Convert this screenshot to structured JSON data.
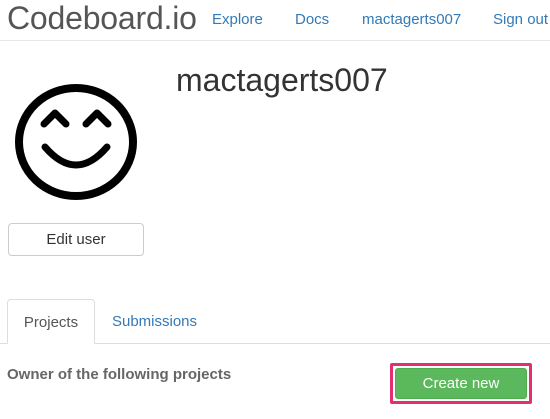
{
  "navbar": {
    "brand": "Codeboard.io",
    "links": [
      {
        "label": "Explore"
      },
      {
        "label": "Docs"
      },
      {
        "label": "mactagerts007"
      },
      {
        "label": "Sign out"
      }
    ]
  },
  "profile": {
    "username": "mactagerts007",
    "avatar_icon": "smiley-face-icon",
    "edit_label": "Edit user"
  },
  "tabs": [
    {
      "label": "Projects",
      "active": true
    },
    {
      "label": "Submissions",
      "active": false
    }
  ],
  "projects": {
    "owner_label": "Owner of the following projects",
    "create_label": "Create new"
  },
  "colors": {
    "link": "#337ab7",
    "create_button": "#5cb85c",
    "highlight_border": "#e0316e"
  }
}
